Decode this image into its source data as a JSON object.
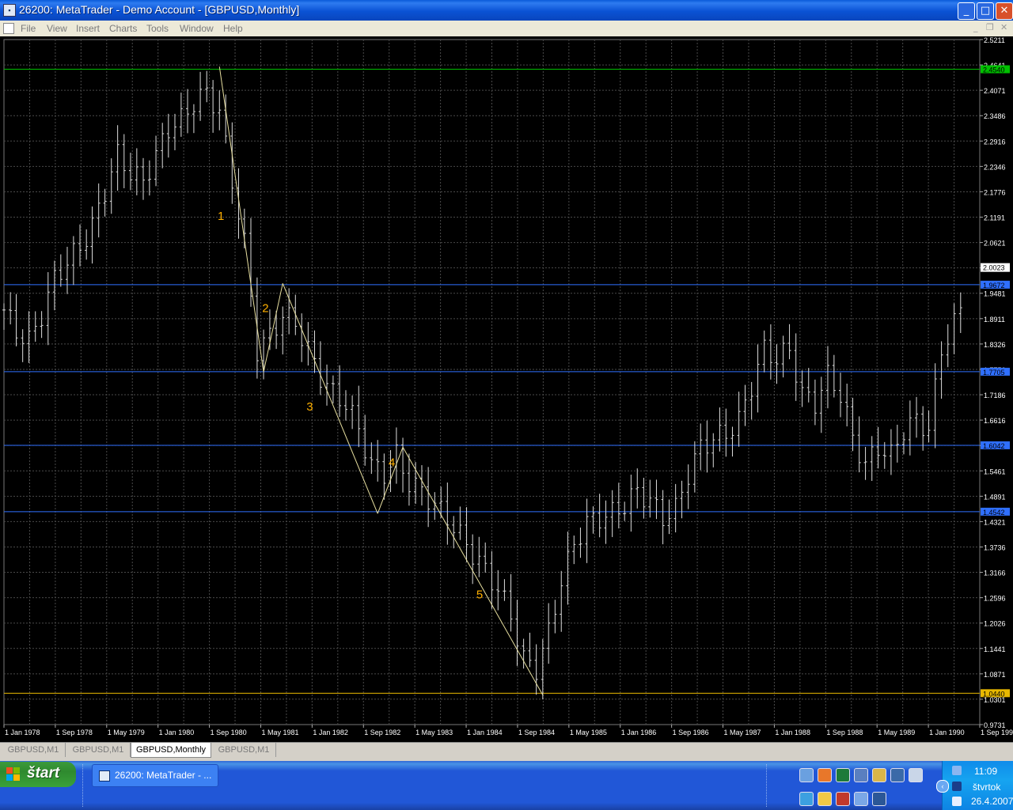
{
  "window": {
    "title": "26200: MetaTrader - Demo Account - [GBPUSD,Monthly]",
    "icon": "metatrader-icon",
    "buttons": {
      "minimize": "_",
      "maximize": "□",
      "close": "✕"
    }
  },
  "menu": {
    "items": [
      "File",
      "View",
      "Insert",
      "Charts",
      "Tools",
      "Window",
      "Help"
    ],
    "mdi_controls": [
      "_",
      "❐",
      "✕"
    ]
  },
  "chart": {
    "symbol": "GBPUSD",
    "timeframe": "Monthly",
    "price_axis": [
      "2.5211",
      "2.4641",
      "2.4071",
      "2.3486",
      "2.2916",
      "2.2346",
      "2.1776",
      "2.1191",
      "2.0621",
      "2.0023",
      "1.9481",
      "1.8911",
      "1.8326",
      "1.7756",
      "1.7186",
      "1.6616",
      "1.6031",
      "1.5461",
      "1.4891",
      "1.4321",
      "1.3736",
      "1.3166",
      "1.2596",
      "1.2026",
      "1.1441",
      "1.0871",
      "1.0301",
      "0.9731"
    ],
    "time_axis": [
      "1 Jan 1978",
      "1 Sep 1978",
      "1 May 1979",
      "1 Jan 1980",
      "1 Sep 1980",
      "1 May 1981",
      "1 Jan 1982",
      "1 Sep 1982",
      "1 May 1983",
      "1 Jan 1984",
      "1 Sep 1984",
      "1 May 1985",
      "1 Jan 1986",
      "1 Sep 1986",
      "1 May 1987",
      "1 Jan 1988",
      "1 Sep 1988",
      "1 May 1989",
      "1 Jan 1990",
      "1 Sep 1990"
    ],
    "levels": [
      {
        "price": 2.454,
        "label": "2.4540",
        "color": "#00c000"
      },
      {
        "price": 1.9672,
        "label": "1.9672",
        "color": "#2f6fff"
      },
      {
        "price": 1.7705,
        "label": "1.7705",
        "color": "#2f6fff"
      },
      {
        "price": 1.6042,
        "label": "1.6042",
        "color": "#2f6fff"
      },
      {
        "price": 1.4542,
        "label": "1.4542",
        "color": "#2f6fff"
      },
      {
        "price": 1.044,
        "label": "1.0440",
        "color": "#e8b800"
      }
    ],
    "current_price_label": "2.0023",
    "wave_labels": [
      "1",
      "2",
      "3",
      "4",
      "5"
    ],
    "colors": {
      "background": "#000000",
      "grid": "#4a4a4a",
      "bars": "#dddddd",
      "wave": "#e8e0a0",
      "wave_label": "#ffb000",
      "axis_text": "#ffffff"
    }
  },
  "chart_data": {
    "type": "ohlc",
    "title": "GBPUSD,Monthly",
    "x": [
      "1978-01",
      "1978-03",
      "1978-05",
      "1978-07",
      "1978-09",
      "1978-11",
      "1979-01",
      "1979-03",
      "1979-05",
      "1979-07",
      "1979-09",
      "1979-11",
      "1980-01",
      "1980-03",
      "1980-05",
      "1980-07",
      "1980-09",
      "1980-11",
      "1981-01",
      "1981-03",
      "1981-05",
      "1981-07",
      "1981-09",
      "1981-11",
      "1982-01",
      "1982-03",
      "1982-05",
      "1982-07",
      "1982-09",
      "1982-11",
      "1983-01",
      "1983-03",
      "1983-05",
      "1983-07",
      "1983-09",
      "1983-11",
      "1984-01",
      "1984-03",
      "1984-05",
      "1984-07",
      "1984-09",
      "1984-11",
      "1985-01",
      "1985-03",
      "1985-05",
      "1985-07",
      "1985-09",
      "1985-11",
      "1986-01",
      "1986-03",
      "1986-05",
      "1986-07",
      "1986-09",
      "1986-11",
      "1987-01",
      "1987-03",
      "1987-05",
      "1987-07",
      "1987-09",
      "1987-11",
      "1988-01",
      "1988-03",
      "1988-05",
      "1988-07",
      "1988-09",
      "1988-11",
      "1989-01",
      "1989-03",
      "1989-05",
      "1989-07",
      "1989-09",
      "1989-11",
      "1990-01",
      "1990-03",
      "1990-05",
      "1990-07",
      "1990-09"
    ],
    "close": [
      1.91,
      1.86,
      1.84,
      1.9,
      1.98,
      2.02,
      2.05,
      2.1,
      2.18,
      2.26,
      2.22,
      2.2,
      2.26,
      2.32,
      2.34,
      2.38,
      2.4,
      2.36,
      2.2,
      2.06,
      1.82,
      1.85,
      1.9,
      1.88,
      1.82,
      1.76,
      1.72,
      1.7,
      1.64,
      1.56,
      1.54,
      1.58,
      1.52,
      1.5,
      1.47,
      1.44,
      1.4,
      1.36,
      1.32,
      1.28,
      1.22,
      1.12,
      1.1,
      1.18,
      1.3,
      1.38,
      1.43,
      1.44,
      1.45,
      1.47,
      1.5,
      1.48,
      1.44,
      1.46,
      1.54,
      1.6,
      1.62,
      1.63,
      1.66,
      1.74,
      1.82,
      1.8,
      1.82,
      1.72,
      1.7,
      1.76,
      1.72,
      1.62,
      1.56,
      1.6,
      1.58,
      1.64,
      1.66,
      1.64,
      1.82,
      1.88,
      1.94
    ],
    "wave_points": [
      {
        "date": "1980-11",
        "price": 2.46,
        "label": ""
      },
      {
        "date": "1981-06",
        "price": 1.77,
        "label": "1"
      },
      {
        "date": "1981-09",
        "price": 1.97,
        "label": "2"
      },
      {
        "date": "1982-12",
        "price": 1.45,
        "label": "3"
      },
      {
        "date": "1983-04",
        "price": 1.6,
        "label": "4"
      },
      {
        "date": "1985-02",
        "price": 1.04,
        "label": "5"
      }
    ],
    "ylim": [
      0.9731,
      2.5211
    ],
    "xlabel": "",
    "ylabel": "",
    "grid": true
  },
  "tabs": [
    {
      "label": "GBPUSD,M1",
      "active": false
    },
    {
      "label": "GBPUSD,M1",
      "active": false
    },
    {
      "label": "GBPUSD,Monthly",
      "active": true
    },
    {
      "label": "GBPUSD,M1",
      "active": false
    }
  ],
  "taskbar": {
    "start_label": "štart",
    "task_item": "26200: MetaTrader - ...",
    "clock": "11:09",
    "day": "štvrtok",
    "date": "26.4.2007"
  }
}
